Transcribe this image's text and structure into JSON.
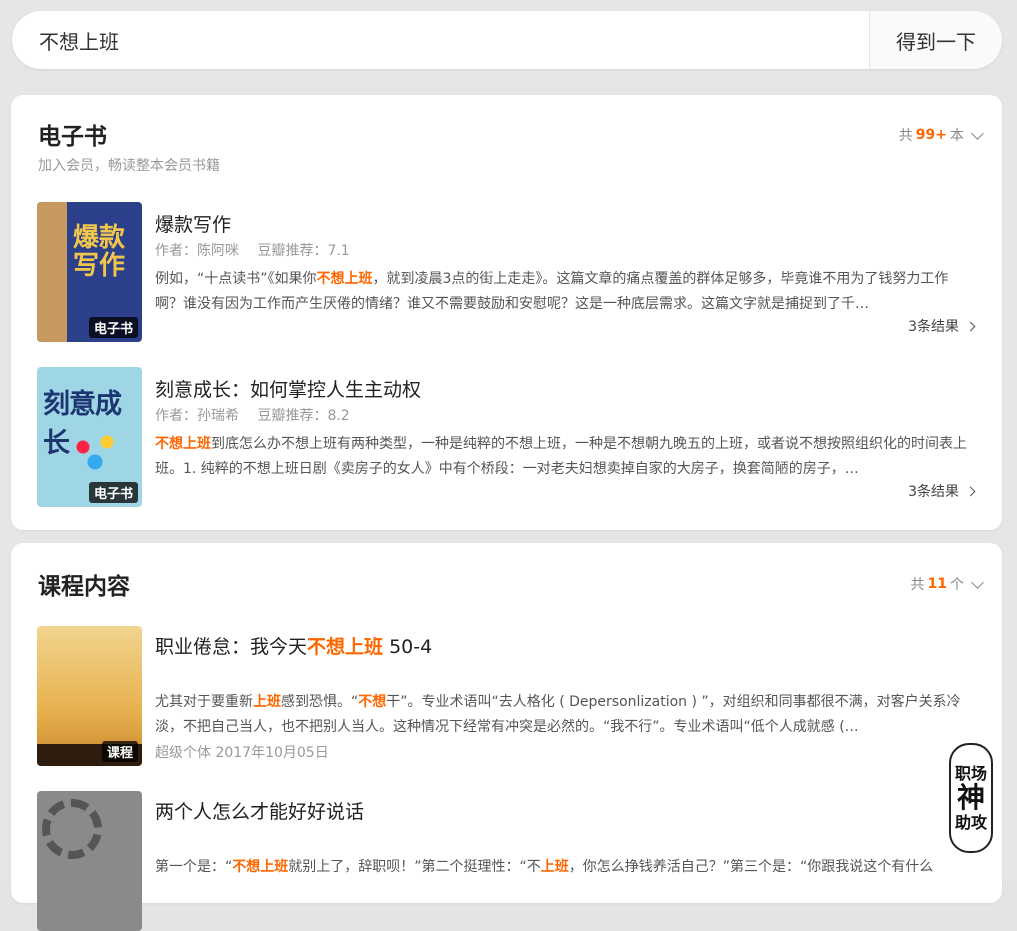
{
  "search": {
    "value": "不想上班",
    "button": "得到一下"
  },
  "ebook_section": {
    "title": "电子书",
    "subtitle": "加入会员，畅读整本会员书籍",
    "count_prefix": "共",
    "count": "99+",
    "count_suffix": "本",
    "items": [
      {
        "title": "爆款写作",
        "author": "作者：陈阿咪",
        "rating": "豆瓣推荐：7.1",
        "badge": "电子书",
        "cover_text": "爆款写作",
        "desc_parts": [
          "例如，“十点读书”《如果你",
          "不想上班",
          "，就到凌晨3点的街上走走》。这篇文章的痛点覆盖的群体足够多，毕竟谁不用为了钱努力工作啊？谁没有因为工作而产生厌倦的情绪？谁又不需要鼓励和安慰呢？这是一种底层需求。这篇文字就是捕捉到了千…"
        ],
        "more": "3条结果"
      },
      {
        "title": "刻意成长：如何掌控人生主动权",
        "author": "作者：孙瑞希",
        "rating": "豆瓣推荐：8.2",
        "badge": "电子书",
        "cover_text": "刻意成长",
        "desc_parts": [
          "",
          "不想上班",
          "到底怎么办不想上班有两种类型，一种是纯粹的不想上班，一种是不想朝九晚五的上班，或者说不想按照组织化的时间表上班。1. 纯粹的不想上班日剧《卖房子的女人》中有个桥段：一对老夫妇想卖掉自家的大房子，换套简陋的房子，…"
        ],
        "more": "3条结果"
      }
    ]
  },
  "course_section": {
    "title": "课程内容",
    "count_prefix": "共",
    "count": "11",
    "count_suffix": "个",
    "items": [
      {
        "title_pre": "职业倦怠：我今天",
        "title_hl": "不想上班",
        "title_post": " 50-4",
        "badge": "课程",
        "desc_a": "尤其对于要重新",
        "desc_hl1": "上班",
        "desc_b": "感到恐惧。“",
        "desc_hl2": "不想",
        "desc_c": "干”。专业术语叫“去人格化 ( Depersonlization ) ”，对组织和同事都很不满，对客户关系冷淡，不把自己当人，也不把别人当人。这种情况下经常有冲突是必然的。“我不行”。专业术语叫“低个人成就感 (…",
        "meta": "超级个体 2017年10月05日"
      },
      {
        "title": "两个人怎么才能好好说话",
        "desc_a": "第一个是：“",
        "desc_hl1": "不想上班",
        "desc_b": "就别上了，辞职呗！”第二个挺理性：“不",
        "desc_hl2": "上班",
        "desc_c": "，你怎么挣钱养活自己？”第三个是：“你跟我说这个有什么"
      }
    ]
  },
  "seal": {
    "line1": "职场",
    "line2": "神",
    "line3": "助攻"
  }
}
